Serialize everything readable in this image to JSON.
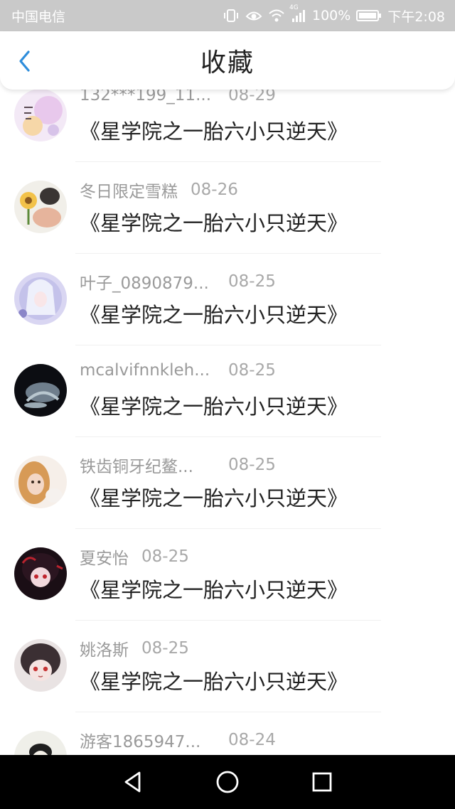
{
  "status_bar": {
    "carrier": "中国电信",
    "network": "4G",
    "battery": "100%",
    "time": "下午2:08",
    "icons": [
      "vibrate-icon",
      "eye-icon",
      "wifi-icon",
      "signal-icon",
      "battery-icon"
    ]
  },
  "header": {
    "title": "收藏",
    "back_icon": "chevron-left-icon",
    "accent": "#2e8ddb"
  },
  "items": [
    {
      "user": "132***199_11...",
      "date": "08-29",
      "book": "《星学院之一胎六小只逆天》"
    },
    {
      "user": "冬日限定雪糕",
      "date": "08-26",
      "book": "《星学院之一胎六小只逆天》"
    },
    {
      "user": "叶子_0890879...",
      "date": "08-25",
      "book": "《星学院之一胎六小只逆天》"
    },
    {
      "user": "mcalvifnnkleh...",
      "date": "08-25",
      "book": "《星学院之一胎六小只逆天》"
    },
    {
      "user": "铁齿铜牙纪鳌...",
      "date": "08-25",
      "book": "《星学院之一胎六小只逆天》"
    },
    {
      "user": "夏安怡",
      "date": "08-25",
      "book": "《星学院之一胎六小只逆天》"
    },
    {
      "user": "姚洛斯",
      "date": "08-25",
      "book": "《星学院之一胎六小只逆天》"
    },
    {
      "user": "游客1865947...",
      "date": "08-24",
      "book": ""
    }
  ],
  "nav_bar": {
    "buttons": [
      "back-triangle-icon",
      "home-circle-icon",
      "recents-square-icon"
    ]
  }
}
